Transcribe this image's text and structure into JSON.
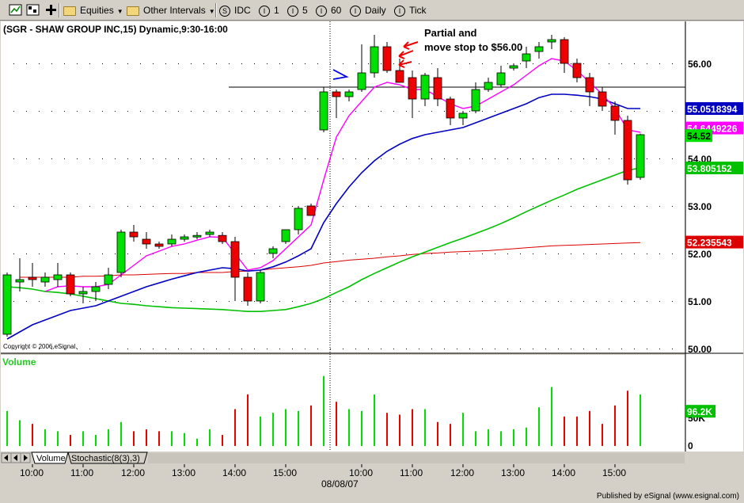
{
  "toolbar": {
    "equities_label": "Equities",
    "other_intervals_label": "Other Intervals",
    "symbol_idc": "IDC",
    "interval_1": "1",
    "interval_5": "5",
    "interval_60": "60",
    "interval_daily": "Daily",
    "interval_tick": "Tick",
    "icons": [
      "chart-window-icon",
      "chart-settings-icon",
      "add-icon"
    ]
  },
  "chart_title": "(SGR - SHAW GROUP INC,15) Dynamic,9:30-16:00",
  "copyright": "Copyright © 2006,eSignal.",
  "annotation_lines": [
    "Partial and",
    "move stop to $56.00"
  ],
  "volume_label": "Volume",
  "tabs": [
    "Volume",
    "Stochastic(8(3),3)"
  ],
  "date_label": "08/08/07",
  "publisher": "Published by eSignal (www.esignal.com)",
  "colors": {
    "up_candle": "#00e000",
    "down_candle": "#ee0000",
    "ma_magenta": "#ff00ff",
    "ma_blue": "#0000c0",
    "ma_green": "#00c000",
    "ma_red": "#dd0000",
    "annotation_red": "#ee0000",
    "annotation_blue": "#0000ee"
  },
  "price_labels": {
    "blue": "55.0518394",
    "magenta_partial": "54.6449226",
    "last": "54.52",
    "green": "53.805152",
    "red": "52.235543"
  },
  "volume_labels": {
    "current": "96.2K",
    "tick_50k": "50K",
    "tick_0": "0"
  },
  "chart_data": {
    "type": "candlestick",
    "title": "(SGR - SHAW GROUP INC,15) Dynamic,9:30-16:00",
    "ylim": [
      50.0,
      56.9
    ],
    "y_ticks": [
      "50.00",
      "51.00",
      "52.00",
      "53.00",
      "54.00",
      "55.00",
      "56.00"
    ],
    "x_ticks": [
      "10:00",
      "11:00",
      "12:00",
      "13:00",
      "14:00",
      "15:00",
      "10:00",
      "11:00",
      "12:00",
      "13:00",
      "14:00",
      "15:00"
    ],
    "x_tick_bars": [
      2,
      6,
      10,
      14,
      18,
      22,
      28,
      32,
      36,
      40,
      44,
      48
    ],
    "session_break_bar": 25.5,
    "horizontal_line": 55.5,
    "horizontal_line_start_bar": 17.5,
    "bars": [
      {
        "o": 50.3,
        "h": 51.6,
        "l": 50.25,
        "c": 51.55
      },
      {
        "o": 51.4,
        "h": 51.9,
        "l": 51.2,
        "c": 51.45
      },
      {
        "o": 51.5,
        "h": 51.8,
        "l": 51.3,
        "c": 51.45
      },
      {
        "o": 51.4,
        "h": 51.6,
        "l": 51.3,
        "c": 51.5
      },
      {
        "o": 51.45,
        "h": 51.8,
        "l": 51.3,
        "c": 51.55
      },
      {
        "o": 51.55,
        "h": 51.6,
        "l": 51.1,
        "c": 51.15
      },
      {
        "o": 51.15,
        "h": 51.3,
        "l": 50.95,
        "c": 51.2
      },
      {
        "o": 51.2,
        "h": 51.4,
        "l": 51.0,
        "c": 51.3
      },
      {
        "o": 51.35,
        "h": 51.7,
        "l": 51.25,
        "c": 51.55
      },
      {
        "o": 51.6,
        "h": 52.5,
        "l": 51.5,
        "c": 52.45
      },
      {
        "o": 52.45,
        "h": 52.6,
        "l": 52.25,
        "c": 52.35
      },
      {
        "o": 52.3,
        "h": 52.45,
        "l": 52.1,
        "c": 52.2
      },
      {
        "o": 52.2,
        "h": 52.25,
        "l": 52.1,
        "c": 52.15
      },
      {
        "o": 52.2,
        "h": 52.4,
        "l": 52.15,
        "c": 52.3
      },
      {
        "o": 52.3,
        "h": 52.4,
        "l": 52.25,
        "c": 52.35
      },
      {
        "o": 52.35,
        "h": 52.45,
        "l": 52.3,
        "c": 52.38
      },
      {
        "o": 52.4,
        "h": 52.5,
        "l": 52.35,
        "c": 52.45
      },
      {
        "o": 52.38,
        "h": 52.45,
        "l": 52.2,
        "c": 52.25
      },
      {
        "o": 52.25,
        "h": 52.35,
        "l": 51.0,
        "c": 51.5
      },
      {
        "o": 51.5,
        "h": 51.6,
        "l": 50.9,
        "c": 51.0
      },
      {
        "o": 51.0,
        "h": 51.65,
        "l": 50.95,
        "c": 51.6
      },
      {
        "o": 52.0,
        "h": 52.15,
        "l": 51.9,
        "c": 52.1
      },
      {
        "o": 52.25,
        "h": 52.5,
        "l": 52.2,
        "c": 52.5
      },
      {
        "o": 52.5,
        "h": 53.0,
        "l": 52.4,
        "c": 52.95
      },
      {
        "o": 53.0,
        "h": 53.05,
        "l": 52.8,
        "c": 52.8
      },
      {
        "o": 54.6,
        "h": 55.5,
        "l": 54.55,
        "c": 55.4
      },
      {
        "o": 55.4,
        "h": 55.45,
        "l": 54.85,
        "c": 55.3
      },
      {
        "o": 55.3,
        "h": 55.45,
        "l": 55.2,
        "c": 55.4
      },
      {
        "o": 55.45,
        "h": 56.4,
        "l": 55.4,
        "c": 55.8
      },
      {
        "o": 55.8,
        "h": 56.6,
        "l": 55.7,
        "c": 56.35
      },
      {
        "o": 56.35,
        "h": 56.45,
        "l": 55.8,
        "c": 55.85
      },
      {
        "o": 55.85,
        "h": 56.1,
        "l": 55.6,
        "c": 55.6
      },
      {
        "o": 55.7,
        "h": 55.85,
        "l": 54.85,
        "c": 55.25
      },
      {
        "o": 55.25,
        "h": 55.8,
        "l": 55.1,
        "c": 55.75
      },
      {
        "o": 55.7,
        "h": 55.9,
        "l": 55.1,
        "c": 55.25
      },
      {
        "o": 55.25,
        "h": 55.3,
        "l": 54.7,
        "c": 54.85
      },
      {
        "o": 54.85,
        "h": 55.0,
        "l": 54.7,
        "c": 54.95
      },
      {
        "o": 55.0,
        "h": 55.6,
        "l": 54.95,
        "c": 55.45
      },
      {
        "o": 55.45,
        "h": 55.7,
        "l": 55.4,
        "c": 55.6
      },
      {
        "o": 55.55,
        "h": 55.95,
        "l": 55.5,
        "c": 55.8
      },
      {
        "o": 55.9,
        "h": 56.0,
        "l": 55.85,
        "c": 55.95
      },
      {
        "o": 56.05,
        "h": 56.35,
        "l": 55.9,
        "c": 56.2
      },
      {
        "o": 56.25,
        "h": 56.45,
        "l": 56.1,
        "c": 56.35
      },
      {
        "o": 56.45,
        "h": 56.6,
        "l": 56.3,
        "c": 56.5
      },
      {
        "o": 56.5,
        "h": 56.55,
        "l": 55.8,
        "c": 56.0
      },
      {
        "o": 56.0,
        "h": 56.1,
        "l": 55.6,
        "c": 55.7
      },
      {
        "o": 55.7,
        "h": 55.8,
        "l": 55.1,
        "c": 55.4
      },
      {
        "o": 55.4,
        "h": 55.5,
        "l": 55.0,
        "c": 55.1
      },
      {
        "o": 55.1,
        "h": 55.2,
        "l": 54.5,
        "c": 54.8
      },
      {
        "o": 54.8,
        "h": 54.9,
        "l": 53.45,
        "c": 53.55
      },
      {
        "o": 53.6,
        "h": 54.52,
        "l": 53.55,
        "c": 54.5
      }
    ],
    "ma_magenta": [
      null,
      null,
      null,
      51.2,
      51.3,
      51.32,
      51.3,
      51.3,
      51.35,
      51.55,
      51.75,
      51.95,
      52.05,
      52.15,
      52.2,
      52.28,
      52.35,
      52.34,
      52.0,
      51.65,
      51.7,
      51.85,
      52.1,
      52.35,
      52.6,
      53.55,
      54.45,
      54.9,
      55.2,
      55.5,
      55.6,
      55.55,
      55.45,
      55.45,
      55.3,
      55.15,
      55.05,
      55.1,
      55.25,
      55.4,
      55.55,
      55.75,
      55.95,
      56.1,
      56.05,
      55.85,
      55.6,
      55.35,
      55.05,
      54.6,
      54.55
    ],
    "ma_blue": [
      50.2,
      50.35,
      50.5,
      50.6,
      50.7,
      50.8,
      50.85,
      50.9,
      51.0,
      51.1,
      51.2,
      51.3,
      51.38,
      51.46,
      51.53,
      51.6,
      51.65,
      51.7,
      51.68,
      51.63,
      51.65,
      51.72,
      51.82,
      51.95,
      52.1,
      52.65,
      53.05,
      53.4,
      53.7,
      53.95,
      54.15,
      54.3,
      54.42,
      54.5,
      54.55,
      54.6,
      54.65,
      54.75,
      54.85,
      54.95,
      55.05,
      55.15,
      55.28,
      55.35,
      55.35,
      55.33,
      55.3,
      55.25,
      55.15,
      55.05,
      55.05
    ],
    "ma_green": [
      51.3,
      51.28,
      51.25,
      51.2,
      51.18,
      51.15,
      51.1,
      51.05,
      51.0,
      50.95,
      50.93,
      50.9,
      50.88,
      50.86,
      50.85,
      50.84,
      50.83,
      50.82,
      50.8,
      50.78,
      50.78,
      50.8,
      50.82,
      50.88,
      50.95,
      51.05,
      51.18,
      51.3,
      51.45,
      51.58,
      51.7,
      51.82,
      51.93,
      52.03,
      52.13,
      52.23,
      52.32,
      52.42,
      52.52,
      52.63,
      52.75,
      52.88,
      53.0,
      53.12,
      53.23,
      53.35,
      53.45,
      53.55,
      53.65,
      53.75,
      53.8
    ],
    "ma_red": [
      null,
      51.5,
      51.5,
      51.5,
      51.5,
      51.5,
      51.52,
      51.52,
      51.53,
      51.55,
      51.55,
      51.56,
      51.57,
      51.58,
      51.58,
      51.6,
      51.6,
      51.6,
      51.62,
      51.63,
      51.65,
      51.68,
      51.7,
      51.72,
      51.75,
      51.8,
      51.83,
      51.86,
      51.88,
      51.9,
      51.93,
      51.95,
      51.98,
      52.0,
      52.01,
      52.03,
      52.04,
      52.05,
      52.06,
      52.08,
      52.1,
      52.12,
      52.14,
      52.16,
      52.17,
      52.18,
      52.19,
      52.2,
      52.21,
      52.22,
      52.23
    ],
    "volume": [
      95,
      70,
      60,
      45,
      40,
      30,
      40,
      30,
      45,
      65,
      40,
      45,
      40,
      40,
      35,
      20,
      45,
      30,
      100,
      140,
      80,
      90,
      100,
      95,
      110,
      190,
      120,
      100,
      95,
      140,
      90,
      85,
      100,
      100,
      65,
      60,
      90,
      40,
      45,
      40,
      45,
      50,
      105,
      160,
      80,
      80,
      95,
      60,
      110,
      150,
      140
    ]
  }
}
